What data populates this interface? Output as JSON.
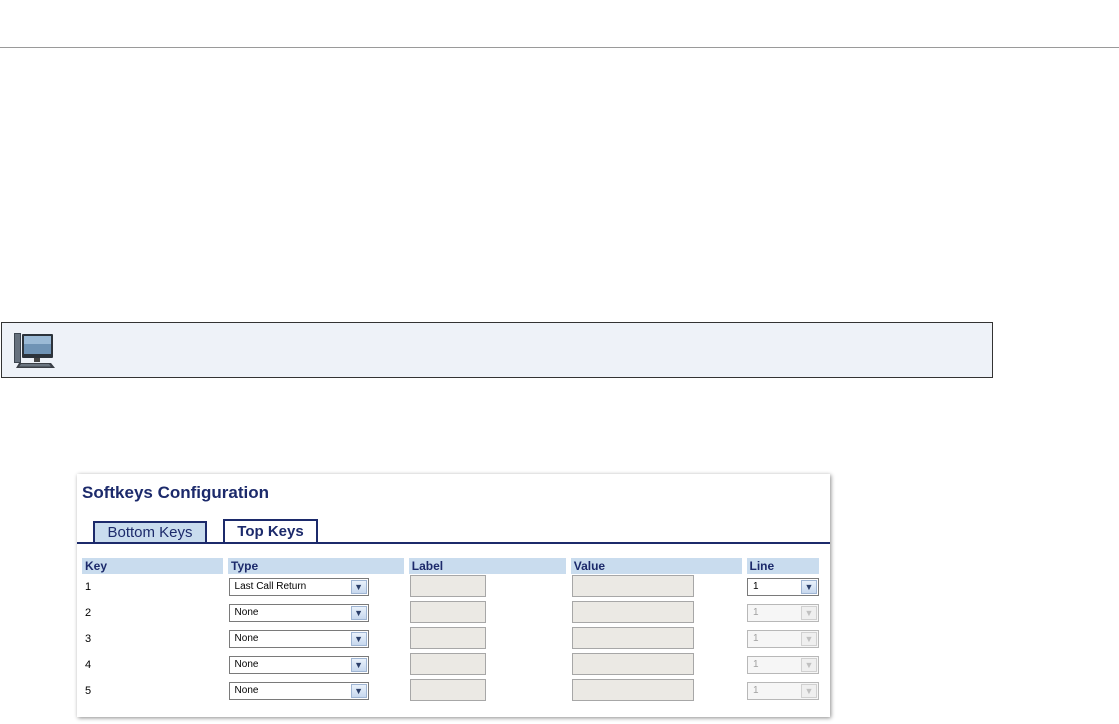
{
  "softkeys": {
    "title": "Softkeys Configuration",
    "tabs": [
      {
        "label": "Bottom Keys",
        "active": false
      },
      {
        "label": "Top Keys",
        "active": true
      }
    ],
    "columns": [
      "Key",
      "Type",
      "Label",
      "Value",
      "Line"
    ],
    "rows": [
      {
        "key": "1",
        "type": "Last Call Return",
        "label": "",
        "value": "",
        "line": "1",
        "line_enabled": true
      },
      {
        "key": "2",
        "type": "None",
        "label": "",
        "value": "",
        "line": "1",
        "line_enabled": false
      },
      {
        "key": "3",
        "type": "None",
        "label": "",
        "value": "",
        "line": "1",
        "line_enabled": false
      },
      {
        "key": "4",
        "type": "None",
        "label": "",
        "value": "",
        "line": "1",
        "line_enabled": false
      },
      {
        "key": "5",
        "type": "None",
        "label": "",
        "value": "",
        "line": "1",
        "line_enabled": false
      }
    ]
  },
  "banner": {
    "icon": "web-ui-computer-icon"
  },
  "colors": {
    "accent": "#1c2a6b",
    "tab_fill": "#c9dcee",
    "banner_bg": "#eef2f8"
  }
}
